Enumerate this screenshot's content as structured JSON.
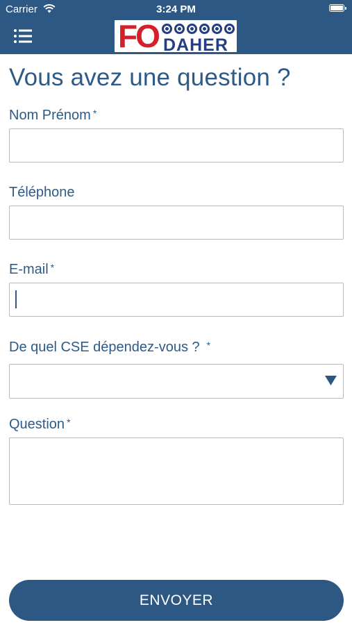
{
  "status_bar": {
    "carrier": "Carrier",
    "time": "3:24 PM",
    "battery_level": 1.0
  },
  "header": {
    "menu_icon": "menu-icon",
    "logo": {
      "mark": "FO",
      "name": "DAHER",
      "mark_color": "#d3202a",
      "name_color": "#233f82"
    }
  },
  "form": {
    "title": "Vous avez une question ?",
    "required_mark": "*",
    "fields": {
      "name": {
        "label": "Nom Prénom",
        "value": "",
        "placeholder": ""
      },
      "phone": {
        "label": "Téléphone",
        "value": "",
        "placeholder": ""
      },
      "email": {
        "label": "E-mail",
        "value": "",
        "placeholder": ""
      },
      "cse": {
        "label": "De quel CSE dépendez-vous ?",
        "selected": ""
      },
      "question": {
        "label": "Question",
        "value": "",
        "placeholder": ""
      }
    },
    "submit_label": "ENVOYER"
  },
  "colors": {
    "primary": "#2e5884",
    "text": "#2d5a86",
    "border": "#b9b9b9",
    "background": "#ffffff"
  }
}
